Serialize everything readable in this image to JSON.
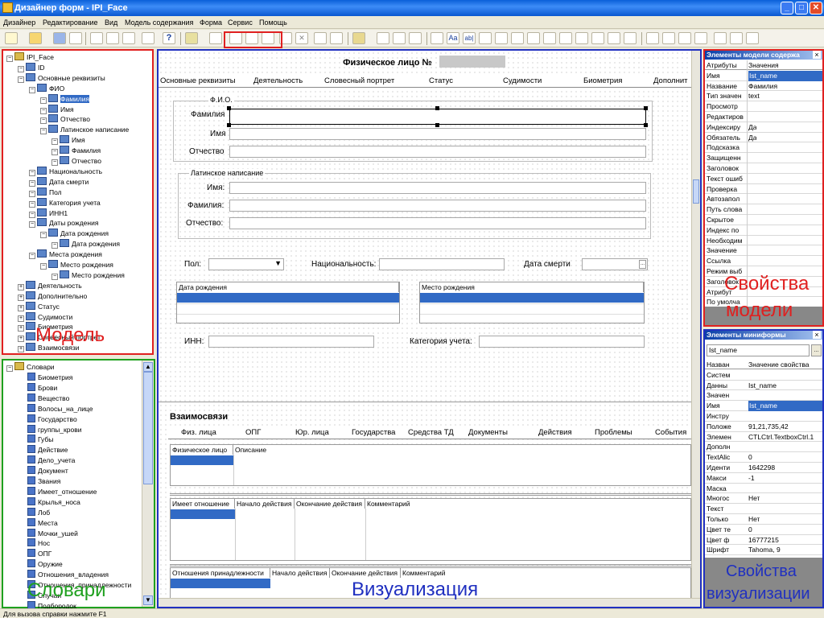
{
  "window": {
    "title": "Дизайнер форм - IPI_Face"
  },
  "menu": [
    "Дизайнер",
    "Редактирование",
    "Вид",
    "Модель содержания",
    "Форма",
    "Сервис",
    "Помощь"
  ],
  "model_tree": {
    "items": [
      {
        "label": "IPI_Face",
        "level": 0
      },
      {
        "label": "ID",
        "level": 1
      },
      {
        "label": "Основные реквизиты",
        "level": 1
      },
      {
        "label": "ФИО",
        "level": 2
      },
      {
        "label": "Фамилия",
        "level": 3,
        "selected": true
      },
      {
        "label": "Имя",
        "level": 3
      },
      {
        "label": "Отчество",
        "level": 3
      },
      {
        "label": "Латинское написание",
        "level": 3
      },
      {
        "label": "Имя",
        "level": 4
      },
      {
        "label": "Фамилия",
        "level": 4
      },
      {
        "label": "Отчество",
        "level": 4
      },
      {
        "label": "Национальность",
        "level": 2
      },
      {
        "label": "Дата смерти",
        "level": 2
      },
      {
        "label": "Пол",
        "level": 2
      },
      {
        "label": "Категория учета",
        "level": 2
      },
      {
        "label": "ИНН1",
        "level": 2
      },
      {
        "label": "Даты рождения",
        "level": 2
      },
      {
        "label": "Дата рождения",
        "level": 3
      },
      {
        "label": "Дата рождения",
        "level": 4
      },
      {
        "label": "Места рождения",
        "level": 2
      },
      {
        "label": "Место рождения",
        "level": 3
      },
      {
        "label": "Место рождения",
        "level": 4
      },
      {
        "label": "Деятельность",
        "level": 1
      },
      {
        "label": "Дополнительно",
        "level": 1
      },
      {
        "label": "Статус",
        "level": 1
      },
      {
        "label": "Судимости",
        "level": 1
      },
      {
        "label": "Биометрия",
        "level": 1
      },
      {
        "label": "Словесный портрет",
        "level": 1
      },
      {
        "label": "Взаимосвязи",
        "level": 1
      }
    ],
    "annotation": "Модель"
  },
  "dict_tree": {
    "root": "Словари",
    "items": [
      "Биометрия",
      "Брови",
      "Вещество",
      "Волосы_на_лице",
      "Государство",
      "группы_крови",
      "Губы",
      "Действие",
      "Дело_учета",
      "Документ",
      "Звания",
      "Имеет_отношение",
      "Крылья_носа",
      "Лоб",
      "Места",
      "Мочки_ушей",
      "Нос",
      "ОПГ",
      "Оружие",
      "Отношения_владения",
      "Отношения_принадлежности",
      "Случаи",
      "Подбородок"
    ],
    "annotation": "Словари"
  },
  "form": {
    "title": "Физическое лицо №",
    "tabs": [
      "Основные реквизиты",
      "Деятельность",
      "Словесный портрет",
      "Статус",
      "Судимости",
      "Биометрия",
      "Дополнит"
    ],
    "fio_group": "Ф.И.О.",
    "fio_labels": [
      "Фамилия",
      "Имя",
      "Отчество"
    ],
    "latin_group": "Латинское написание",
    "latin_labels": [
      "Имя:",
      "Фамилия:",
      "Отчество:"
    ],
    "gender_label": "Пол:",
    "nationality_label": "Национальность:",
    "death_label": "Дата смерти",
    "birth_grid_header": "Дата рождения",
    "place_grid_header": "Место рождения",
    "inn_label": "ИНН:",
    "category_label": "Категория учета:",
    "relations_title": "Взаимосвязи",
    "relations_tabs": [
      "Физ. лица",
      "ОПГ",
      "Юр. лица",
      "Государства",
      "Средства ТД",
      "Документы",
      "Действия",
      "Проблемы",
      "События"
    ],
    "grid1_headers": [
      "Физическое лицо",
      "Описание"
    ],
    "grid2_headers": [
      "Имеет отношение",
      "Начало действия",
      "Окончание действия",
      "Комментарий"
    ],
    "grid3_headers": [
      "Отношения принадлежности",
      "Начало действия",
      "Окончание действия",
      "Комментарий"
    ],
    "annotation": "Визуализация"
  },
  "model_props": {
    "title": "Элементы модели содержа",
    "col_attr": "Атрибуты",
    "col_val": "Значения",
    "rows": [
      [
        "Имя",
        "Ist_name"
      ],
      [
        "Название",
        "Фамилия"
      ],
      [
        "Тип значен",
        "text"
      ],
      [
        "Просмотр",
        ""
      ],
      [
        "Редактиров",
        ""
      ],
      [
        "Индексиру",
        "Да"
      ],
      [
        "Обязатель",
        "Да"
      ],
      [
        "Подсказка",
        ""
      ],
      [
        "Защищенн",
        ""
      ],
      [
        "Заголовок",
        ""
      ],
      [
        "Текст ошиб",
        ""
      ],
      [
        "Проверка",
        ""
      ],
      [
        "Автозапол",
        ""
      ],
      [
        "Путь слова",
        ""
      ],
      [
        "Скрытое",
        ""
      ],
      [
        "Индекс по",
        ""
      ],
      [
        "Необходим",
        ""
      ],
      [
        "Значение",
        ""
      ],
      [
        "Ссылка",
        ""
      ],
      [
        "Режим выб",
        ""
      ],
      [
        "Заголовок",
        ""
      ],
      [
        "Атрибут",
        ""
      ],
      [
        "По умолча",
        ""
      ]
    ],
    "annotation_l1": "Свойства",
    "annotation_l2": "модели"
  },
  "vis_props": {
    "title": "Элементы миниформы",
    "selector_value": "Ist_name",
    "col_name": "Назван",
    "col_val": "Значение свойства",
    "rows": [
      [
        "Систем",
        ""
      ],
      [
        "Данны",
        "Ist_name"
      ],
      [
        "Значен",
        ""
      ],
      [
        "Имя",
        "Ist_name"
      ],
      [
        "Инстру",
        ""
      ],
      [
        "Положе",
        "91,21,735,42"
      ],
      [
        "Элемен",
        "CTLCtrl.TextboxCtrl.1"
      ],
      [
        "Дополн",
        ""
      ],
      [
        "TextAlic",
        "0"
      ],
      [
        "Иденти",
        "1642298"
      ],
      [
        "Макси",
        "-1"
      ],
      [
        "Маска",
        ""
      ],
      [
        "Многос",
        "Нет"
      ],
      [
        "Текст",
        ""
      ],
      [
        "Только",
        "Нет"
      ],
      [
        "Цвет те",
        "0"
      ],
      [
        "Цвет ф",
        "16777215"
      ],
      [
        "Шрифт",
        "Tahoma, 9"
      ]
    ],
    "annotation_l1": "Свойства",
    "annotation_l2": "визуализации"
  },
  "status": "Для вызова справки нажмите F1",
  "colors": {
    "accent": "#316ac5",
    "red": "#e02020",
    "green": "#1fa01f",
    "blue": "#2030c0"
  }
}
